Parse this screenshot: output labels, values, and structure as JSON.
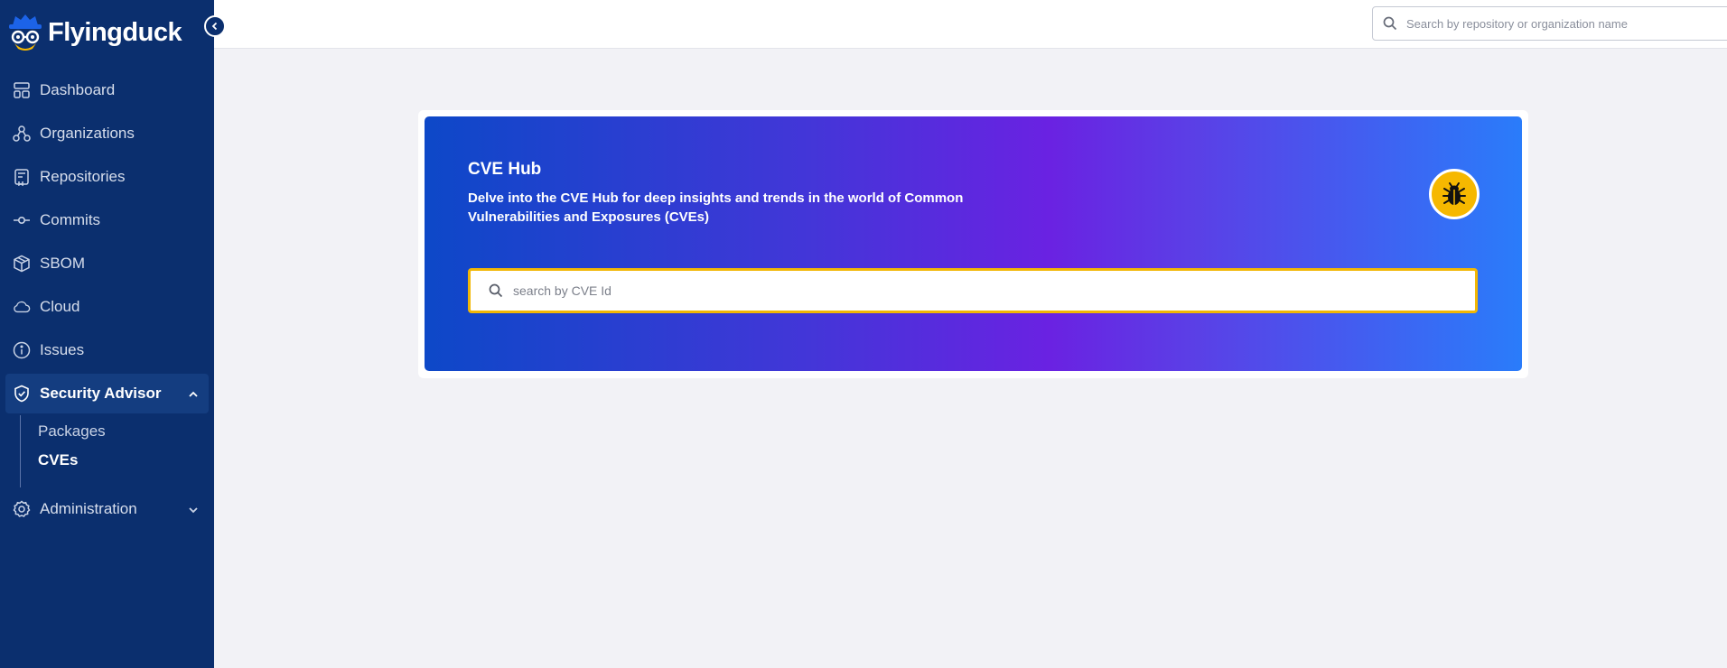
{
  "app": {
    "name": "Flyingduck"
  },
  "sidebar": {
    "items": [
      {
        "label": "Dashboard",
        "icon": "dashboard-icon"
      },
      {
        "label": "Organizations",
        "icon": "organizations-icon"
      },
      {
        "label": "Repositories",
        "icon": "repositories-icon"
      },
      {
        "label": "Commits",
        "icon": "commit-icon"
      },
      {
        "label": "SBOM",
        "icon": "package-box-icon"
      },
      {
        "label": "Cloud",
        "icon": "cloud-icon"
      },
      {
        "label": "Issues",
        "icon": "info-icon"
      }
    ],
    "security_advisor": {
      "label": "Security Advisor",
      "icon": "shield-check-icon",
      "expanded": true,
      "children": [
        {
          "label": "Packages",
          "active": false
        },
        {
          "label": "CVEs",
          "active": true
        }
      ]
    },
    "administration": {
      "label": "Administration",
      "icon": "gear-icon",
      "expanded": false
    }
  },
  "topbar": {
    "search_placeholder": "Search by repository or organization name"
  },
  "hero": {
    "title": "CVE Hub",
    "description": "Delve into the CVE Hub for deep insights and trends in the world of Common Vulnerabilities and Exposures (CVEs)",
    "search_placeholder": "search by CVE Id",
    "badge_icon": "bug-icon"
  },
  "colors": {
    "sidebar_bg": "#0b2f6e",
    "active_item_bg": "#143d80",
    "search_focus_border": "#f2b705",
    "badge_bg": "#f6b800",
    "gradient_start": "#0d48c8",
    "gradient_mid": "#6a22e2",
    "gradient_end": "#2a7cfa"
  }
}
